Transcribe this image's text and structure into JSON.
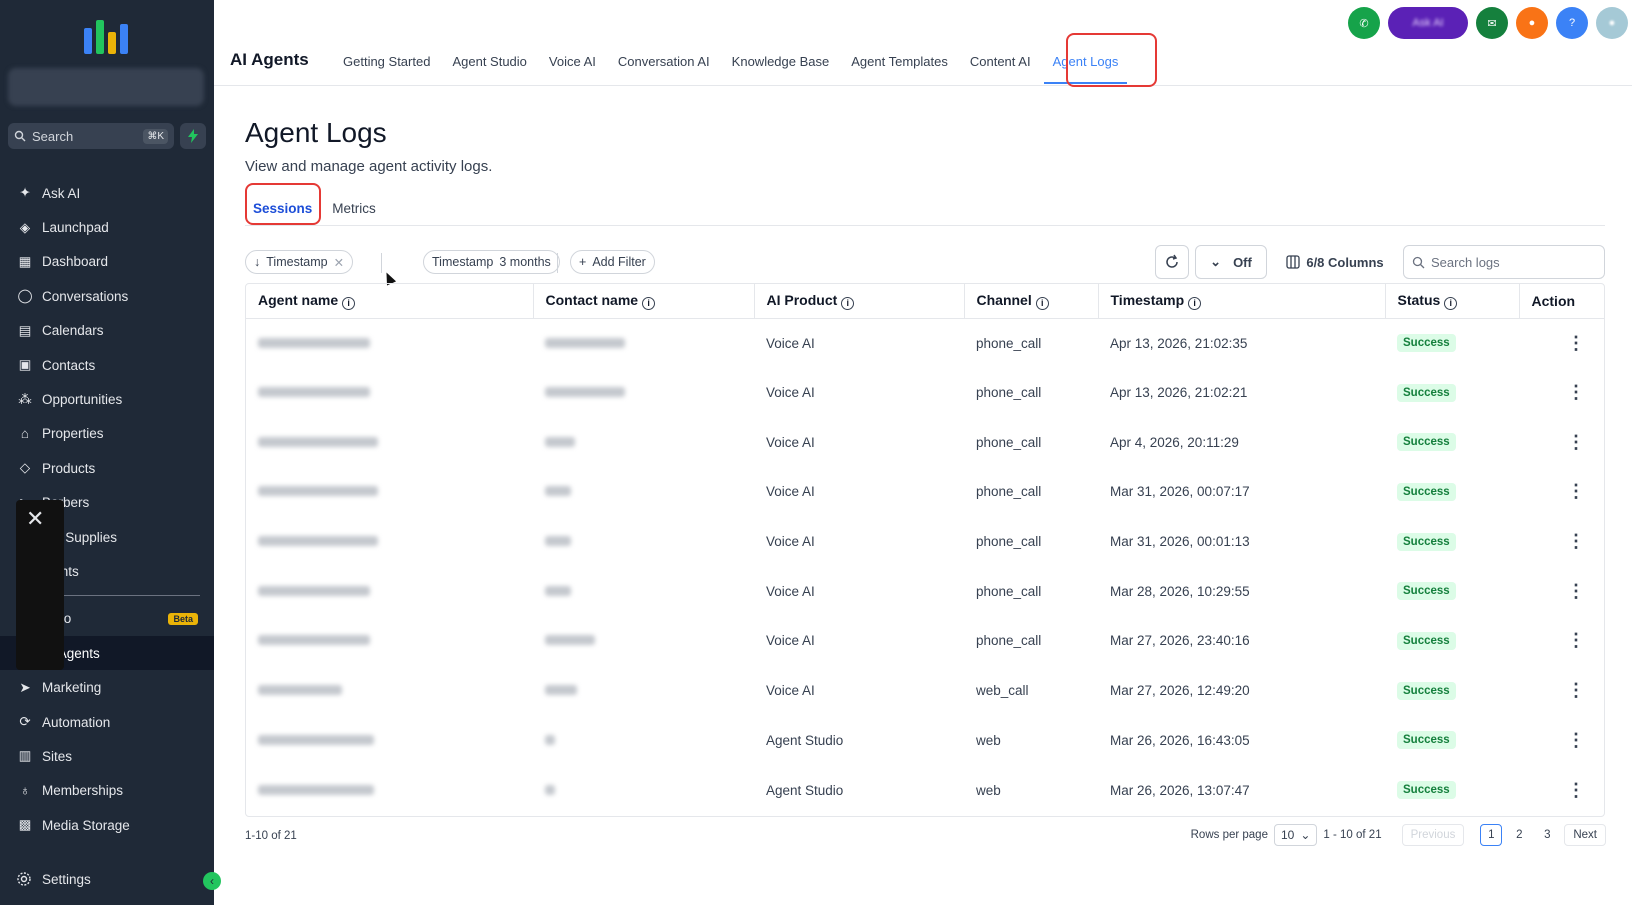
{
  "sidebar": {
    "search_placeholder": "Search",
    "search_shortcut": "⌘K",
    "items": [
      {
        "label": "Ask AI",
        "icon": "sparkle-icon"
      },
      {
        "label": "Launchpad",
        "icon": "rocket-icon"
      },
      {
        "label": "Dashboard",
        "icon": "grid-icon"
      },
      {
        "label": "Conversations",
        "icon": "chat-icon"
      },
      {
        "label": "Calendars",
        "icon": "calendar-icon"
      },
      {
        "label": "Contacts",
        "icon": "contacts-icon"
      },
      {
        "label": "Opportunities",
        "icon": "opportunities-icon"
      },
      {
        "label": "Properties",
        "icon": "house-icon"
      },
      {
        "label": "Products",
        "icon": "box-icon"
      },
      {
        "label": "Barbers",
        "icon": "barbers-icon"
      },
      {
        "label": "ber Supplies",
        "icon": "supplies-icon"
      },
      {
        "label": "ments",
        "icon": "payments-icon"
      }
    ],
    "studio_label": "tudio",
    "beta_badge": "Beta",
    "items_bottom": [
      {
        "label": "AI Agents",
        "icon": "ai-agents-icon",
        "active": true
      },
      {
        "label": "Marketing",
        "icon": "send-icon"
      },
      {
        "label": "Automation",
        "icon": "automation-icon"
      },
      {
        "label": "Sites",
        "icon": "sites-icon"
      },
      {
        "label": "Memberships",
        "icon": "memberships-icon"
      },
      {
        "label": "Media Storage",
        "icon": "media-icon"
      }
    ],
    "settings_label": "Settings",
    "overlay_close": "✕"
  },
  "header": {
    "app_title": "AI Agents",
    "tabs": [
      "Getting Started",
      "Agent Studio",
      "Voice AI",
      "Conversation AI",
      "Knowledge Base",
      "Agent Templates",
      "Content AI",
      "Agent Logs"
    ],
    "active_tab": "Agent Logs",
    "ask_ai_label": "Ask AI"
  },
  "page": {
    "title": "Agent Logs",
    "subtitle": "View and manage agent activity logs.",
    "sub_tabs": [
      "Sessions",
      "Metrics"
    ]
  },
  "filters": {
    "sort_chip": "Timestamp",
    "range_chip_label": "Timestamp",
    "range_chip_value": "3 months",
    "add_filter": "Add Filter",
    "toggle_label": "Off",
    "columns_label": "6/8 Columns",
    "search_placeholder": "Search logs"
  },
  "table": {
    "headers": [
      "Agent name",
      "Contact name",
      "AI Product",
      "Channel",
      "Timestamp",
      "Status",
      "Action"
    ],
    "rows": [
      {
        "ai_product": "Voice AI",
        "channel": "phone_call",
        "timestamp": "Apr 13, 2026, 21:02:35",
        "status": "Success"
      },
      {
        "ai_product": "Voice AI",
        "channel": "phone_call",
        "timestamp": "Apr 13, 2026, 21:02:21",
        "status": "Success"
      },
      {
        "ai_product": "Voice AI",
        "channel": "phone_call",
        "timestamp": "Apr 4, 2026, 20:11:29",
        "status": "Success"
      },
      {
        "ai_product": "Voice AI",
        "channel": "phone_call",
        "timestamp": "Mar 31, 2026, 00:07:17",
        "status": "Success"
      },
      {
        "ai_product": "Voice AI",
        "channel": "phone_call",
        "timestamp": "Mar 31, 2026, 00:01:13",
        "status": "Success"
      },
      {
        "ai_product": "Voice AI",
        "channel": "phone_call",
        "timestamp": "Mar 28, 2026, 10:29:55",
        "status": "Success"
      },
      {
        "ai_product": "Voice AI",
        "channel": "phone_call",
        "timestamp": "Mar 27, 2026, 23:40:16",
        "status": "Success"
      },
      {
        "ai_product": "Voice AI",
        "channel": "web_call",
        "timestamp": "Mar 27, 2026, 12:49:20",
        "status": "Success"
      },
      {
        "ai_product": "Agent Studio",
        "channel": "web",
        "timestamp": "Mar 26, 2026, 16:43:05",
        "status": "Success"
      },
      {
        "ai_product": "Agent Studio",
        "channel": "web",
        "timestamp": "Mar 26, 2026, 13:07:47",
        "status": "Success"
      }
    ]
  },
  "footer": {
    "count_text": "1-10 of 21",
    "rows_per_page_label": "Rows per page",
    "rows_per_page_value": "10",
    "range_text": "1 - 10 of 21",
    "previous": "Previous",
    "pages": [
      "1",
      "2",
      "3"
    ],
    "next": "Next"
  },
  "colors": {
    "sidebar_bg": "#1f2937",
    "accent": "#3b82f6",
    "highlight": "#e53935",
    "success_bg": "#dcfce7",
    "success_text": "#15803d"
  }
}
